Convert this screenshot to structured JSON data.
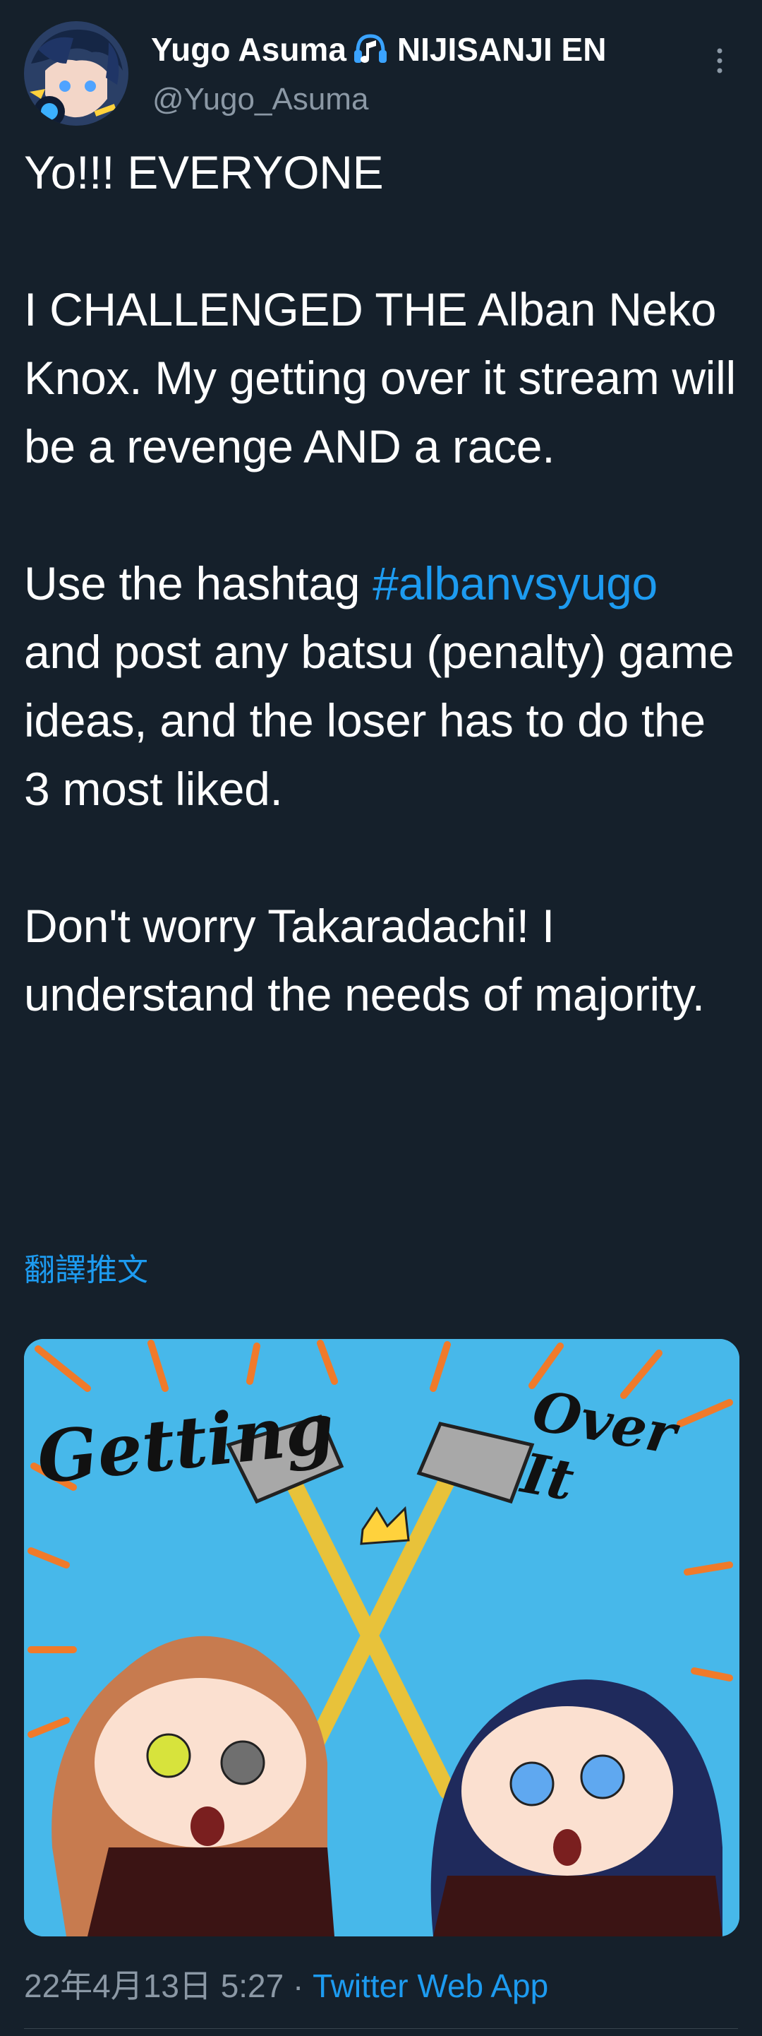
{
  "author": {
    "display_name": "Yugo Asuma",
    "affiliation": "NIJISANJI EN",
    "handle": "@Yugo_Asuma",
    "badge_icon": "music-note-icon",
    "avatar": "avatar-illustration"
  },
  "tweet": {
    "paragraph_1": "Yo!!! EVERYONE",
    "paragraph_2": "I CHALLENGED THE Alban Neko Knox. My getting over it stream will be a revenge AND a race.",
    "paragraph_3_before": "Use the hashtag",
    "hashtag": "#albanvsyugo",
    "paragraph_3_after": "and post any batsu (penalty) game ideas, and the loser has to do the 3 most liked.",
    "paragraph_4": "Don't worry Takaradachi! I understand the needs of majority.",
    "translate_label": "翻譯推文"
  },
  "media": {
    "title_left": "Getting",
    "title_right": "Over It"
  },
  "meta": {
    "timestamp": "22年4月13日 5:27",
    "separator": "·",
    "source": "Twitter Web App"
  },
  "colors": {
    "background": "#15202b",
    "text": "#ffffff",
    "secondary": "#8b98a5",
    "link": "#1d9bf0",
    "divider": "#38444d"
  },
  "icons": {
    "more": "more-vertical-icon"
  }
}
